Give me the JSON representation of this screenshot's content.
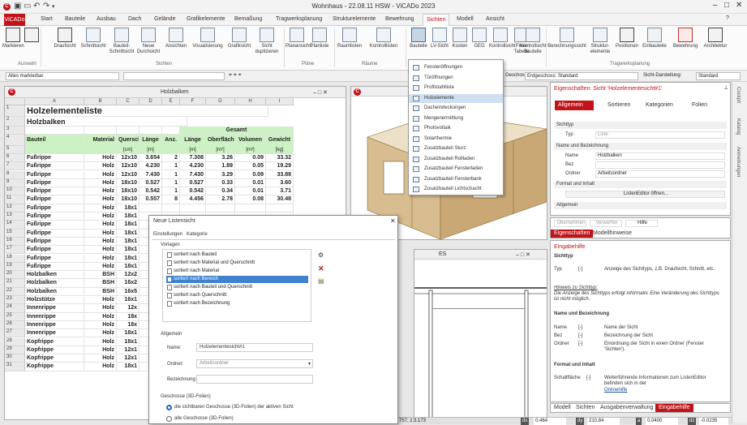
{
  "title_bar": {
    "title": "Wohnhaus - 22.08.11 HSW - ViCADo 2023",
    "min": "–",
    "max": "□",
    "close": "✕"
  },
  "tabs": [
    "ViCADo",
    "Start",
    "Bauteile",
    "Ausbau",
    "Dach",
    "Gelände",
    "Grafikelemente",
    "Bemaßung",
    "Tragwerksplanung",
    "Strukturelemente",
    "Bewehrung",
    "Sichten",
    "Modell",
    "Ansicht"
  ],
  "ribbon": {
    "buttons": [
      "Markieren",
      "Draufsicht",
      "Schnittsicht",
      "Bauteil-Schnittsicht",
      "Neue Durchsicht",
      "Ansichten",
      "Visualisierung",
      "Grafiksicht",
      "Sicht duplizieren",
      "Planansicht",
      "Planliste",
      "Raumlisten",
      "Kontrolllisten",
      "Bauteile",
      "LV-Sicht",
      "Kosten",
      "GEG",
      "Kontrollsicht",
      "Freie Tabelle",
      "Kontrollsicht Bauteile",
      "Berechnungssicht",
      "Struktur-elemente",
      "Positionen",
      "Einbauteile",
      "Bewehrung",
      "Architektur"
    ],
    "groups": [
      "Auswahl",
      "Sichten",
      "Pläne",
      "Räume",
      "Tragwerksplanung"
    ]
  },
  "filter_bar": {
    "selection": "Alles markierbar",
    "floor_label": "Geschoss:",
    "floor": "Erdgeschoss: Standard",
    "view_mode_label": "Sicht-Darstellung:",
    "view_mode": "Standard"
  },
  "sheet_window": {
    "title": "Holzbalken",
    "columns": [
      "A",
      "B",
      "C",
      "D",
      "E",
      "F",
      "G",
      "H",
      "I"
    ],
    "heading1": "Holzelementeliste",
    "heading2": "Holzbalken",
    "gesamt": "Gesamt",
    "header": [
      "Bauteil",
      "Material",
      "Querschnitt",
      "Länge",
      "Anz.",
      "Länge",
      "Oberfläche",
      "Volumen",
      "Gewicht"
    ],
    "units": [
      "",
      "",
      "[cm]",
      "[m]",
      "",
      "[m]",
      "[m²]",
      "[m³]",
      "[kg]"
    ],
    "rows": [
      [
        "Fußrippe",
        "Holz",
        "12x10",
        "3.654",
        "2",
        "7.308",
        "3.26",
        "0.09",
        "33.32"
      ],
      [
        "Fußrippe",
        "Holz",
        "12x10",
        "4.230",
        "1",
        "4.230",
        "1.89",
        "0.05",
        "19.29"
      ],
      [
        "Fußrippe",
        "Holz",
        "12x10",
        "7.430",
        "1",
        "7.430",
        "3.29",
        "0.09",
        "33.88"
      ],
      [
        "Fußrippe",
        "Holz",
        "18x10",
        "0.527",
        "1",
        "0.527",
        "0.33",
        "0.01",
        "3.60"
      ],
      [
        "Fußrippe",
        "Holz",
        "18x10",
        "0.542",
        "1",
        "0.542",
        "0.34",
        "0.01",
        "3.71"
      ],
      [
        "Fußrippe",
        "Holz",
        "18x10",
        "0.557",
        "8",
        "4.456",
        "2.78",
        "0.08",
        "30.48"
      ],
      [
        "Fußrippe",
        "Holz",
        "18x1",
        "",
        "",
        "",
        "",
        "",
        ""
      ],
      [
        "Fußrippe",
        "Holz",
        "18x1",
        "",
        "",
        "",
        "",
        "",
        ""
      ],
      [
        "Fußrippe",
        "Holz",
        "18x1",
        "",
        "",
        "",
        "",
        "",
        ""
      ],
      [
        "Fußrippe",
        "Holz",
        "18x1",
        "",
        "",
        "",
        "",
        "",
        ""
      ],
      [
        "Fußrippe",
        "Holz",
        "18x1",
        "",
        "",
        "",
        "",
        "",
        ""
      ],
      [
        "Fußrippe",
        "Holz",
        "18x1",
        "",
        "",
        "",
        "",
        "",
        ""
      ],
      [
        "Fußrippe",
        "Holz",
        "18x1",
        "",
        "",
        "",
        "",
        "",
        ""
      ],
      [
        "Fußrippe",
        "Holz",
        "18x1",
        "",
        "",
        "",
        "",
        "",
        ""
      ],
      [
        "Holzbalken",
        "BSH",
        "12x2",
        "",
        "",
        "",
        "",
        "",
        ""
      ],
      [
        "Holzbalken",
        "BSH",
        "16x2",
        "",
        "",
        "",
        "",
        "",
        ""
      ],
      [
        "Holzbalken",
        "BSH",
        "16x5",
        "",
        "",
        "",
        "",
        "",
        ""
      ],
      [
        "Holzstütze",
        "Holz",
        "16x1",
        "",
        "",
        "",
        "",
        "",
        ""
      ],
      [
        "Innenrippe",
        "Holz",
        "12x",
        "",
        "",
        "",
        "",
        "",
        ""
      ],
      [
        "Innenrippe",
        "Holz",
        "18x",
        "",
        "",
        "",
        "",
        "",
        ""
      ],
      [
        "Innenrippe",
        "Holz",
        "18x",
        "",
        "",
        "",
        "",
        "",
        ""
      ],
      [
        "Innenrippe",
        "Holz",
        "18x1",
        "",
        "",
        "",
        "",
        "",
        ""
      ],
      [
        "Kopfrippe",
        "Holz",
        "18x1",
        "",
        "",
        "",
        "",
        "",
        ""
      ],
      [
        "Kopfrippe",
        "Holz",
        "12x1",
        "",
        "",
        "",
        "",
        "",
        ""
      ],
      [
        "Kopfrippe",
        "Holz",
        "12x1",
        "",
        "",
        "",
        "",
        "",
        ""
      ],
      [
        "Kopfrippe",
        "Holz",
        "18x1",
        "",
        "",
        "",
        "",
        "",
        ""
      ]
    ]
  },
  "view_es": {
    "title": "ES"
  },
  "dropdown": {
    "items": [
      "Fensteröffnungen",
      "Türöffnungen",
      "Profilstahlliste",
      "Holzelemente",
      "Dacheindeckungen",
      "Mengenermittlung",
      "Photovoltaik",
      "Solarthermie",
      "Zusatzbauteil Sturz",
      "Zusatzbauteil Rollladen",
      "Zusatzbauteil Fensterladen",
      "Zusatzbauteil Fensterbank",
      "Zusatzbauteil Lichtschacht"
    ],
    "highlighted_index": 3
  },
  "dialog": {
    "title": "Neue Listensicht",
    "tabs": [
      "Einstellungen",
      "Kategorie"
    ],
    "vorlagen_label": "Vorlagen",
    "vorlagen": [
      "sortiert nach Bauteil",
      "sortiert nach Material und Querschnitt",
      "sortiert nach Material",
      "sortiert nach Bereich",
      "sortiert nach Bauteil und Querschnitt",
      "sortiert nach Querschnitt",
      "sortiert nach Bezeichnung"
    ],
    "selected_vorlage_index": 3,
    "allgemein_label": "Allgemein",
    "name_label": "Name:",
    "name_value": "Holzelementesicht#1",
    "ordner_label": "Ordner:",
    "ordner_value": "Arbeitsordner",
    "bezeichnung_label": "Bezeichnung:",
    "bezeichnung_value": "",
    "geschosse_label": "Geschosse (3D-Folien)",
    "radio1": "die sichtbaren Geschosse (3D-Folien) der aktiven Sicht",
    "radio2": "alle Geschosse (3D-Folien)"
  },
  "props": {
    "title": "Eigenschaften: Sicht 'Holzelementesicht#1'",
    "tabs": [
      "Allgemein",
      "Sortieren",
      "Kategorien",
      "Folien"
    ],
    "sichttyp_section": "Sichttyp",
    "typ_label": "Typ",
    "typ_value": "Liste",
    "name_section": "Name und Bezeichnung",
    "name_label": "Name",
    "name_value": "Holzbalken",
    "bez_label": "Bez",
    "ordner_label": "Ordner",
    "ordner_value": "Arbeitsordner",
    "format_section": "Format und Inhalt",
    "listeditor_button": "ListenEditor öffnen...",
    "allgemein_section": "Allgemein",
    "buttons": [
      "Übernehmen",
      "Verwerfen",
      "Hilfe"
    ],
    "bottom_tabs": [
      "Eigenschaften",
      "Modellhinweise"
    ]
  },
  "help": {
    "title": "Eingabehilfe",
    "s1": "Sichttyp",
    "typ_label": "Typ",
    "typ_unit": "[-]",
    "typ_desc": "Anzeige des Sichttyps, z.B. Draufsicht, Schnitt, etc.",
    "hint_title": "Hinweis zu Sichttyp:",
    "hint_body": "Die Anzeige des Sichttyps erfolgt informativ. Eine Veränderung des Sichttyps ist nicht möglich.",
    "s2": "Name und Bezeichnung",
    "name_label": "Name",
    "name_unit": "[-]",
    "name_desc": "Name der Sicht",
    "bez_label": "Bez",
    "bez_unit": "[-]",
    "bez_desc": "Bezeichnung der Sicht",
    "ordner_label": "Ordner",
    "ordner_unit": "[-]",
    "ordner_desc": "Einordnung der Sicht in einen Ordner (Fenster 'Sichten').",
    "s3": "Format und Inhalt",
    "sf_label": "Schaltfläche",
    "sf_unit": "[-]",
    "sf_desc": "Weiterführende Informationen zum ListenEditor befinden sich in der",
    "sf_link": "Onlinehilfe",
    "bottom_tabs": [
      "Modell",
      "Sichten",
      "Ausgabenverwaltung",
      "Eingabehilfe"
    ]
  },
  "side_tabs": [
    "Cockpit",
    "Katalog",
    "Anmerkungen"
  ],
  "status": {
    "coords": "757, z:3.173",
    "dx_label": "dx",
    "dx": "0.464",
    "dy_label": "dy",
    "dy": "210.84",
    "a_label": "a",
    "a": "0.0400",
    "da_label": "dz",
    "da": "-0.0235"
  }
}
